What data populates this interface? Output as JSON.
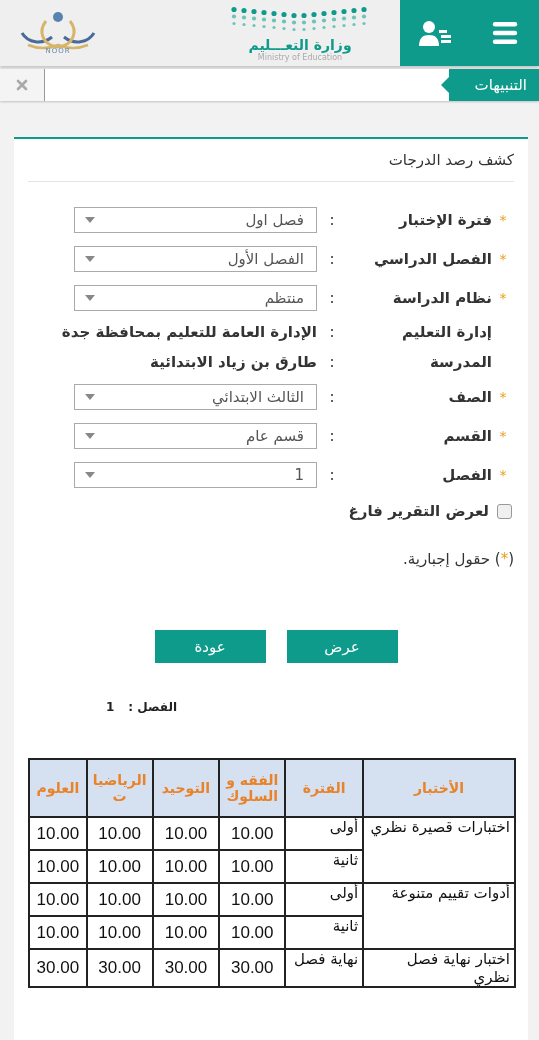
{
  "header": {
    "ministry_name": "وزارة التعـــليم",
    "ministry_subtitle": "Ministry of Education",
    "noor_name": "NOOR"
  },
  "alerts": {
    "label": "التنبيهات"
  },
  "card": {
    "title": "كشف رصد الدرجات",
    "required_mark": "*",
    "fields": [
      {
        "kind": "select",
        "label": "فترة الإختبار",
        "required": true,
        "colon": ":",
        "value": "فصل اول"
      },
      {
        "kind": "select",
        "label": "الفصل الدراسي",
        "required": true,
        "colon": ":",
        "value": "الفصل الأول"
      },
      {
        "kind": "select",
        "label": "نظام الدراسة",
        "required": true,
        "colon": ":",
        "value": "منتظم"
      },
      {
        "kind": "info",
        "label": "إدارة التعليم",
        "required": false,
        "colon": ":",
        "value": "الإدارة العامة للتعليم بمحافظة جدة"
      },
      {
        "kind": "info",
        "label": "المدرسة",
        "required": false,
        "colon": ":",
        "value": "طارق بن زياد الابتدائية"
      },
      {
        "kind": "select",
        "label": "الصف",
        "required": true,
        "colon": ":",
        "value": "الثالث الابتدائي"
      },
      {
        "kind": "select",
        "label": "القسم",
        "required": true,
        "colon": ":",
        "value": "قسم عام"
      },
      {
        "kind": "select",
        "label": "الفصل",
        "required": true,
        "colon": ":",
        "value": "1"
      }
    ],
    "checkbox": {
      "label": "لعرض التقرير فارغ",
      "checked": false
    },
    "note": {
      "prefix": "(",
      "mark": "*",
      "suffix": ")",
      "text": "حقول إجبارية."
    },
    "buttons": [
      "عرض",
      "عودة"
    ],
    "class_label": "الفصل :",
    "class_value": "1",
    "table": {
      "columns": [
        "الأختبار",
        "الفترة",
        "الفقه و السلوك",
        "التوحيد",
        "الرياضيات",
        "العلوم"
      ],
      "groups": [
        {
          "test": "اختبارات قصيرة نظري",
          "periods": [
            {
              "period": "أولى",
              "values": [
                "10.00",
                "10.00",
                "10.00",
                "10.00"
              ]
            },
            {
              "period": "ثانية",
              "values": [
                "10.00",
                "10.00",
                "10.00",
                "10.00"
              ]
            }
          ]
        },
        {
          "test": "أدوات تقييم متنوعة",
          "periods": [
            {
              "period": "أولى",
              "values": [
                "10.00",
                "10.00",
                "10.00",
                "10.00"
              ]
            },
            {
              "period": "ثانية",
              "values": [
                "10.00",
                "10.00",
                "10.00",
                "10.00"
              ]
            }
          ]
        },
        {
          "test": "اختبار نهاية فصل نظري",
          "periods": [
            {
              "period": "نهاية فصل",
              "values": [
                "30.00",
                "30.00",
                "30.00",
                "30.00"
              ]
            }
          ]
        }
      ]
    }
  }
}
